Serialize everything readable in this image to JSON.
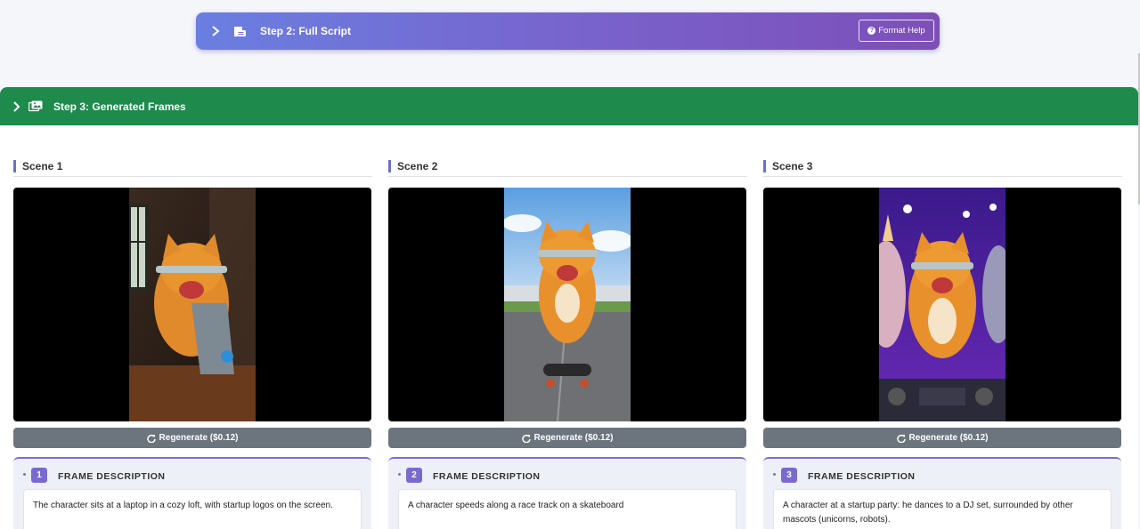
{
  "step2": {
    "title": "Step 2: Full Script",
    "help_label": "Format Help",
    "gradient_start": "#6a7fe0",
    "gradient_end": "#7d4fb8"
  },
  "step3": {
    "title": "Step 3: Generated Frames",
    "color": "#1e8a4c"
  },
  "scenes": [
    {
      "label": "Scene 1",
      "image": "cat-at-laptop-loft-image",
      "regenerate_label": "Regenerate ($0.12)",
      "frame_number": "1",
      "frame_heading": "FRAME DESCRIPTION",
      "description": "The character sits at a laptop in a cozy loft, with startup logos on the screen."
    },
    {
      "label": "Scene 2",
      "image": "cat-on-skateboard-race-track-image",
      "regenerate_label": "Regenerate ($0.12)",
      "frame_number": "2",
      "frame_heading": "FRAME DESCRIPTION",
      "description": "A character speeds along a race track on a skateboard"
    },
    {
      "label": "Scene 3",
      "image": "cat-dj-party-with-mascots-image",
      "regenerate_label": "Regenerate ($0.12)",
      "frame_number": "3",
      "frame_heading": "FRAME DESCRIPTION",
      "description": "A character at a startup party: he dances to a DJ set, surrounded by other mascots (unicorns, robots)."
    }
  ]
}
